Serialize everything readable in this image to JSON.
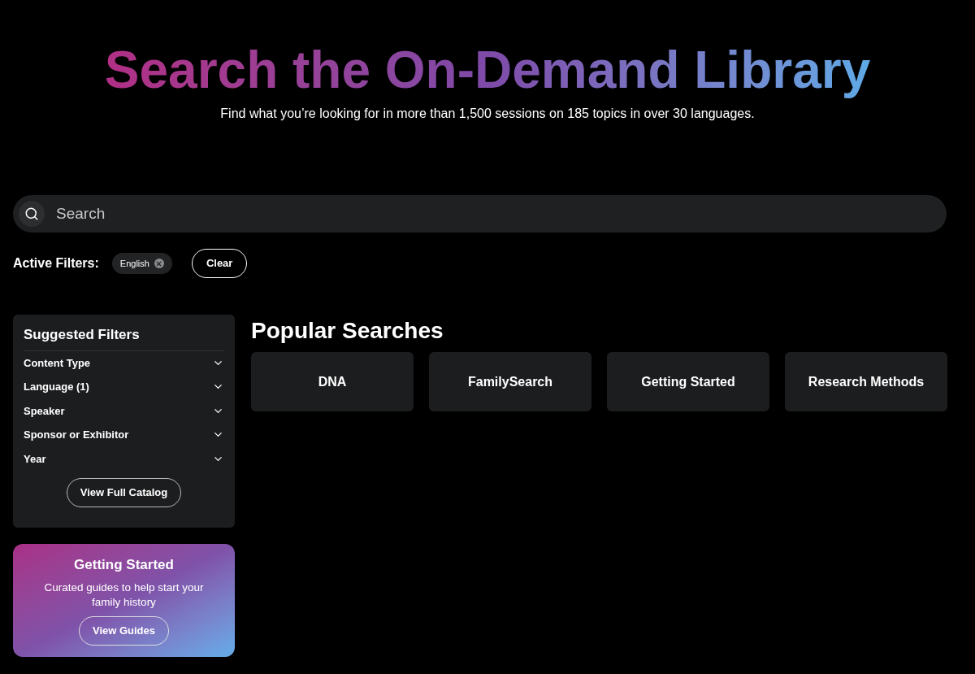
{
  "header": {
    "title": "Search the On-Demand Library",
    "subtitle": "Find what you’re looking for in more than 1,500 sessions on 185 topics in over 30 languages."
  },
  "search": {
    "placeholder": "Search"
  },
  "active_filters": {
    "label": "Active Filters:",
    "chips": [
      "English"
    ],
    "clear": "Clear"
  },
  "suggested_filters": {
    "title": "Suggested Filters",
    "items": [
      {
        "label": "Content Type",
        "expanded": false
      },
      {
        "label": "Language (1)",
        "expanded": false
      },
      {
        "label": "Speaker",
        "expanded": false
      },
      {
        "label": "Sponsor or Exhibitor",
        "expanded": false
      },
      {
        "label": "Year",
        "expanded": false
      }
    ],
    "button": "View Full Catalog"
  },
  "promo": {
    "title": "Getting Started",
    "text": "Curated guides to help start your family history",
    "button": "View Guides"
  },
  "popular": {
    "title": "Popular Searches",
    "items": [
      "DNA",
      "FamilySearch",
      "Getting Started",
      "Research Methods"
    ]
  }
}
